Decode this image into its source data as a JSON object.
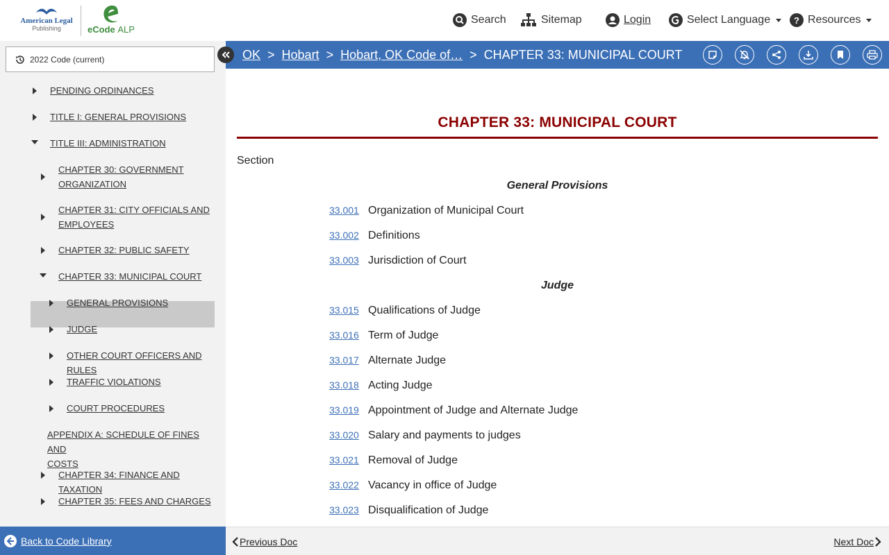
{
  "brand": {
    "publisher_line1": "American Legal",
    "publisher_line2": "Publishing",
    "product_name": "eCode",
    "product_suffix": "ALP"
  },
  "topnav": {
    "search": "Search",
    "sitemap": "Sitemap",
    "login": "Login",
    "language": "Select Language",
    "resources": "Resources"
  },
  "sidebar": {
    "version": "2022 Code (current)",
    "items": [
      {
        "label": "PENDING ORDINANCES",
        "state": "collapsed"
      },
      {
        "label": "TITLE I: GENERAL PROVISIONS",
        "state": "collapsed"
      },
      {
        "label": "TITLE III: ADMINISTRATION",
        "state": "expanded"
      },
      {
        "label": "CHAPTER 30: GOVERNMENT",
        "label2": "ORGANIZATION",
        "state": "collapsed"
      },
      {
        "label": "CHAPTER 31: CITY OFFICIALS AND",
        "label2": "EMPLOYEES",
        "state": "collapsed"
      },
      {
        "label": "CHAPTER 32: PUBLIC SAFETY",
        "state": "collapsed"
      },
      {
        "label": "CHAPTER 33: MUNICIPAL COURT",
        "state": "expanded",
        "active": true
      },
      {
        "label": "GENERAL PROVISIONS",
        "state": "collapsed"
      },
      {
        "label": "JUDGE",
        "state": "collapsed"
      },
      {
        "label": "OTHER COURT OFFICERS AND RULES",
        "state": "collapsed"
      },
      {
        "label": "TRAFFIC VIOLATIONS",
        "state": "collapsed"
      },
      {
        "label": "COURT PROCEDURES",
        "state": "collapsed"
      },
      {
        "label": "APPENDIX A: SCHEDULE OF FINES AND",
        "label2": "COSTS",
        "state": "leaf"
      },
      {
        "label": "CHAPTER 34: FINANCE AND TAXATION",
        "state": "collapsed"
      },
      {
        "label": "CHAPTER 35: FEES AND CHARGES",
        "state": "collapsed"
      }
    ]
  },
  "breadcrumb": {
    "items": [
      "OK",
      "Hobart",
      "Hobart, OK Code of…"
    ],
    "current": "CHAPTER 33: MUNICIPAL COURT",
    "separator": ">"
  },
  "toolbar": {
    "icons": [
      "note-icon",
      "alert-off-icon",
      "share-icon",
      "download-icon",
      "bookmark-icon",
      "print-icon"
    ]
  },
  "content": {
    "title": "CHAPTER 33: MUNICIPAL COURT",
    "section_label": "Section",
    "groups": [
      {
        "heading": "General Provisions",
        "sections": [
          {
            "num": "33.001",
            "title": "Organization of Municipal Court"
          },
          {
            "num": "33.002",
            "title": "Definitions"
          },
          {
            "num": "33.003",
            "title": "Jurisdiction of Court"
          }
        ]
      },
      {
        "heading": "Judge",
        "sections": [
          {
            "num": "33.015",
            "title": "Qualifications of Judge"
          },
          {
            "num": "33.016",
            "title": "Term of Judge"
          },
          {
            "num": "33.017",
            "title": "Alternate Judge"
          },
          {
            "num": "33.018",
            "title": "Acting Judge"
          },
          {
            "num": "33.019",
            "title": "Appointment of Judge and Alternate Judge"
          },
          {
            "num": "33.020",
            "title": "Salary and payments to judges"
          },
          {
            "num": "33.021",
            "title": "Removal of Judge"
          },
          {
            "num": "33.022",
            "title": "Vacancy in office of Judge"
          },
          {
            "num": "33.023",
            "title": "Disqualification of Judge"
          }
        ]
      }
    ]
  },
  "footer": {
    "back": "Back to Code Library",
    "prev": "Previous Doc",
    "next": "Next Doc"
  },
  "colors": {
    "accent_blue": "#3b6fb6",
    "title_red": "#8b0000",
    "sidebar_bg": "#f2f2f2"
  }
}
